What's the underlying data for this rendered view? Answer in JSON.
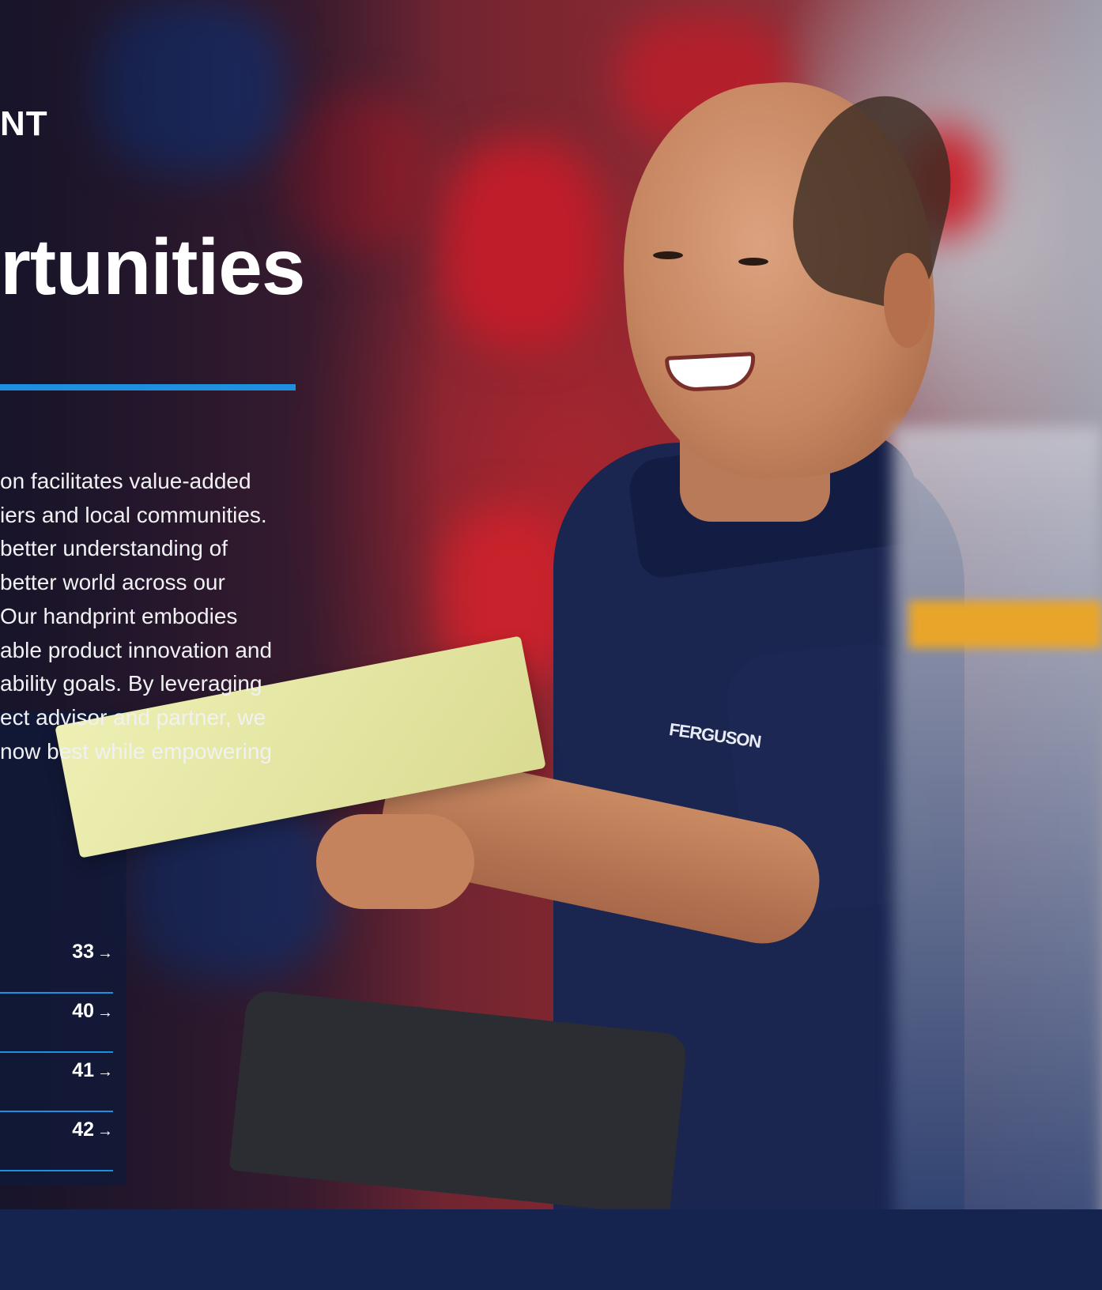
{
  "section_label": "NT",
  "headline": "rtunities",
  "body_lines": [
    "on facilitates value-added",
    "iers and local communities.",
    " better understanding of",
    "better world across our",
    " Our handprint embodies",
    "able product innovation and",
    "ability goals. By leveraging",
    "ect advisor and partner, we",
    "now best while empowering"
  ],
  "toc": [
    {
      "page": "33",
      "arrow": "→"
    },
    {
      "page": "40",
      "arrow": "→"
    },
    {
      "page": "41",
      "arrow": "→"
    },
    {
      "page": "42",
      "arrow": "→"
    }
  ],
  "photo": {
    "shirt_logo": "FERGUSON"
  },
  "colors": {
    "accent_blue": "#1f8fe0",
    "text": "#ffffff",
    "shirt_navy": "#1a2550"
  }
}
